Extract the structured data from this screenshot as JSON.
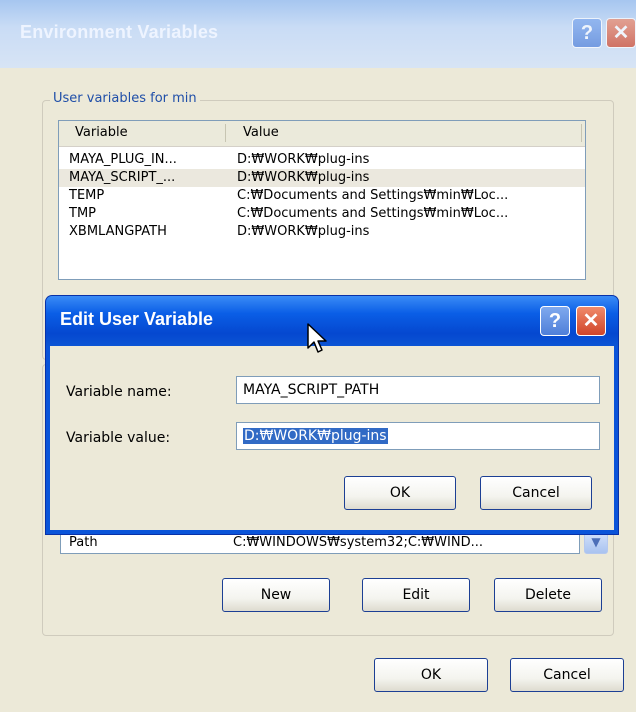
{
  "env_window": {
    "title": "Environment Variables",
    "user_group_label": "User variables for min",
    "columns": [
      "Variable",
      "Value"
    ],
    "rows": [
      {
        "variable": "MAYA_PLUG_IN...",
        "value": "D:₩WORK₩plug-ins"
      },
      {
        "variable": "MAYA_SCRIPT_...",
        "value": "D:₩WORK₩plug-ins"
      },
      {
        "variable": "TEMP",
        "value": "C:₩Documents and Settings₩min₩Loc..."
      },
      {
        "variable": "TMP",
        "value": "C:₩Documents and Settings₩min₩Loc..."
      },
      {
        "variable": "XBMLANGPATH",
        "value": "D:₩WORK₩plug-ins"
      }
    ],
    "selected_row": 1,
    "system_row": {
      "variable": "Path",
      "value": "C:₩WINDOWS₩system32;C:₩WIND..."
    },
    "buttons": {
      "new": "New",
      "edit": "Edit",
      "delete": "Delete",
      "ok": "OK",
      "cancel": "Cancel"
    }
  },
  "edit_dialog": {
    "title": "Edit User Variable",
    "name_label": "Variable name:",
    "name_value": "MAYA_SCRIPT_PATH",
    "value_label": "Variable value:",
    "value_value": "D:₩WORK₩plug-ins",
    "ok": "OK",
    "cancel": "Cancel"
  },
  "icons": {
    "help": "?",
    "close": "✕",
    "scroll_down": "▼"
  },
  "colors": {
    "title_blue": "#0a54d9",
    "selection": "#316ac5",
    "window_bg": "#ece9d8"
  }
}
